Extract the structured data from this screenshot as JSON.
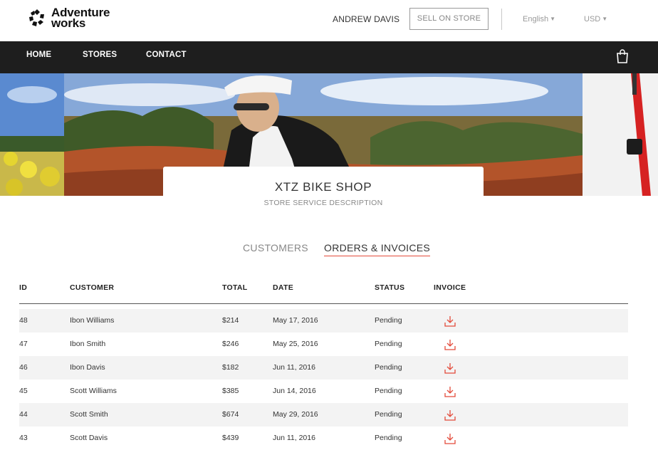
{
  "brand": {
    "line1": "Adventure",
    "line2": "works"
  },
  "header": {
    "user_name": "ANDREW DAVIS",
    "sell_button": "SELL ON STORE",
    "language": "English",
    "currency": "USD"
  },
  "nav": {
    "items": [
      "HOME",
      "STORES",
      "CONTACT"
    ]
  },
  "store": {
    "name": "XTZ BIKE SHOP",
    "description": "STORE SERVICE DESCRIPTION"
  },
  "tabs": [
    {
      "label": "CUSTOMERS",
      "active": false
    },
    {
      "label": "ORDERS & INVOICES",
      "active": true
    }
  ],
  "table": {
    "columns": [
      "ID",
      "CUSTOMER",
      "TOTAL",
      "DATE",
      "STATUS",
      "INVOICE"
    ],
    "rows": [
      {
        "id": "48",
        "customer": "Ibon Williams",
        "total": "$214",
        "date": "May 17, 2016",
        "status": "Pending"
      },
      {
        "id": "47",
        "customer": "Ibon Smith",
        "total": "$246",
        "date": "May 25, 2016",
        "status": "Pending"
      },
      {
        "id": "46",
        "customer": "Ibon Davis",
        "total": "$182",
        "date": "Jun 11, 2016",
        "status": "Pending"
      },
      {
        "id": "45",
        "customer": "Scott Williams",
        "total": "$385",
        "date": "Jun 14, 2016",
        "status": "Pending"
      },
      {
        "id": "44",
        "customer": "Scott Smith",
        "total": "$674",
        "date": "May 29, 2016",
        "status": "Pending"
      },
      {
        "id": "43",
        "customer": "Scott Davis",
        "total": "$439",
        "date": "Jun 11, 2016",
        "status": "Pending"
      }
    ]
  },
  "colors": {
    "accent": "#e34a3a",
    "nav_bg": "#1e1e1e",
    "row_alt": "#f3f3f3"
  },
  "icons": {
    "logo": "logo-icon",
    "cart": "shopping-bag-icon",
    "invoice": "download-icon"
  }
}
